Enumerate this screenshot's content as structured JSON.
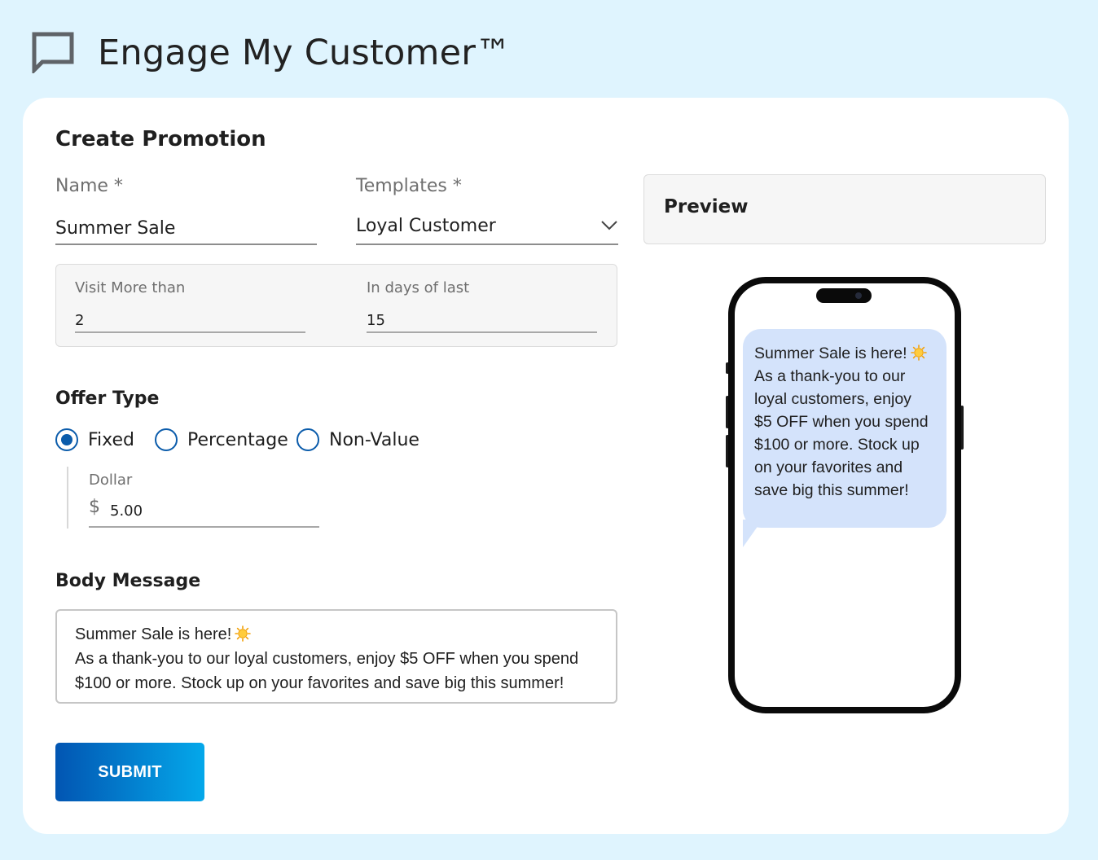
{
  "app": {
    "title": "Engage My Customer™",
    "icon": "chat-bubble-icon"
  },
  "form": {
    "title": "Create Promotion",
    "name": {
      "label": "Name *",
      "value": "Summer Sale"
    },
    "templates": {
      "label": "Templates *",
      "selected": "Loyal Customer"
    },
    "criteria": {
      "visit_label": "Visit More than",
      "visit_value": "2",
      "days_label": "In days of last",
      "days_value": "15"
    },
    "offer_type": {
      "title": "Offer Type",
      "options": [
        "Fixed",
        "Percentage",
        "Non-Value"
      ],
      "selected": "Fixed"
    },
    "dollar": {
      "label": "Dollar",
      "symbol": "$",
      "value": "5.00"
    },
    "body_message": {
      "title": "Body Message",
      "line1": "Summer Sale is here!",
      "line2": "As a thank-you to our loyal customers, enjoy $5 OFF when you spend",
      "line3": "$100 or more. Stock up on your favorites and save big this summer!"
    },
    "submit_label": "SUBMIT"
  },
  "preview": {
    "title": "Preview",
    "message_first": "Summer Sale is here!",
    "message_rest": "As a thank-you to our\nloyal customers, enjoy\n$5 OFF when you spend\n$100 or more. Stock up\non your favorites and\nsave big this summer!"
  },
  "colors": {
    "background": "#dff4fe",
    "accent": "#0b5cab",
    "bubble": "#d4e3fb",
    "button_gradient_start": "#0255b2",
    "button_gradient_end": "#04a8ea"
  }
}
